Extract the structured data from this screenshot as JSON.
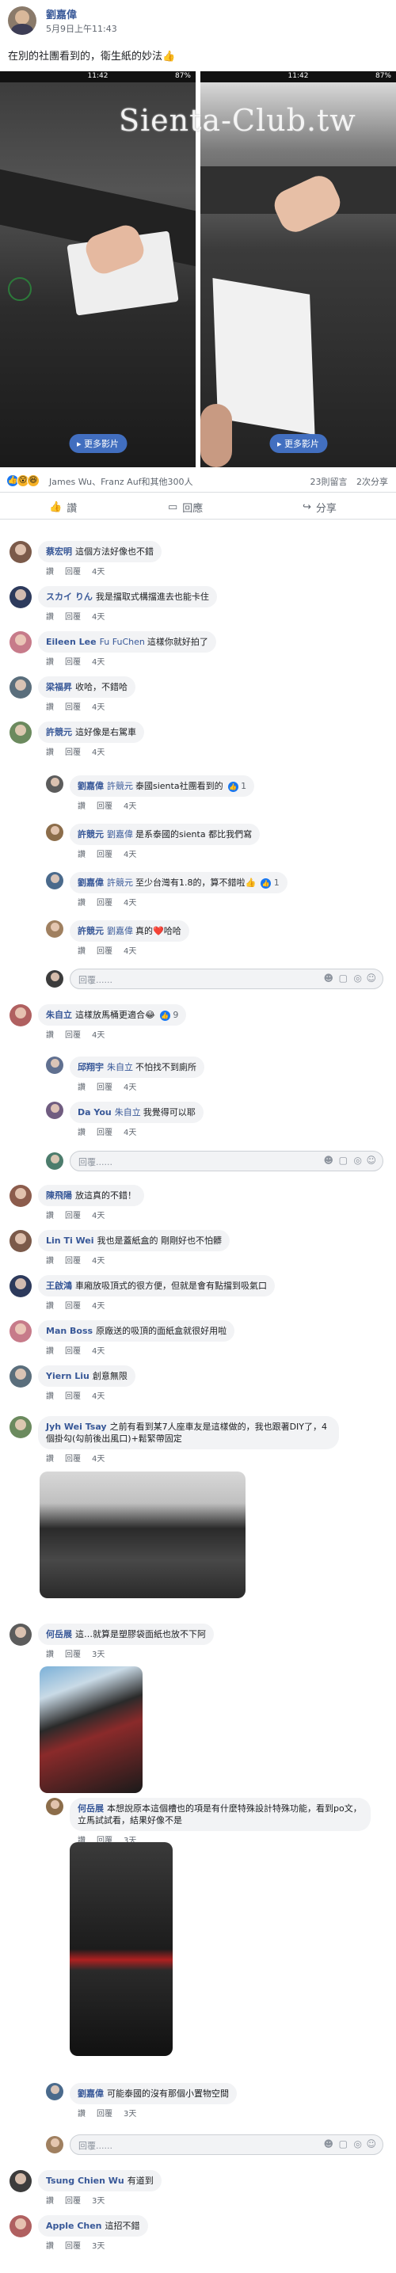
{
  "post": {
    "author": "劉嘉偉",
    "time": "5月9日上午11:43",
    "text": "在別的社團看到的，衛生紙的妙法👍",
    "watermark": "Sienta-Club.tw"
  },
  "photos": [
    {
      "status_time": "11:42",
      "battery": "87%",
      "button": "更多影片"
    },
    {
      "status_time": "11:42",
      "battery": "87%",
      "button": "更多影片"
    }
  ],
  "reactions": {
    "summary": "James Wu、Franz Auf和其他300人",
    "comments_count": "23則留言",
    "shares_count": "2次分享"
  },
  "actions": {
    "like": "讚",
    "comment": "回應",
    "share": "分享"
  },
  "labels": {
    "reply": "回覆",
    "like": "讚",
    "input_placeholder": "回覆......"
  },
  "comments": [
    {
      "name": "蔡宏明",
      "text": "這個方法好像也不錯",
      "time": "4天"
    },
    {
      "name": "スカイ りん",
      "text": "我是擋取式構擋進去也能卡住",
      "time": "4天"
    },
    {
      "name": "Eileen Lee",
      "tag": "Fu FuChen",
      "text": "這樣你就好拍了",
      "time": "4天"
    },
    {
      "name": "梁福昇",
      "text": "收哈，不錯哈",
      "time": "4天"
    },
    {
      "name": "許競元",
      "text": "這好像是右駕車",
      "time": "4天",
      "replies": [
        {
          "name": "劉嘉偉",
          "tag": "許競元",
          "text": "泰國sienta社團看到的",
          "time": "4天",
          "likes": "1"
        },
        {
          "name": "許競元",
          "tag": "劉嘉偉",
          "text": "是系泰國的sienta 都比我們寫",
          "time": "4天"
        },
        {
          "name": "劉嘉偉",
          "tag": "許競元",
          "text": "至少台灣有1.8的，算不錯啦👍",
          "time": "4天",
          "likes": "1"
        },
        {
          "name": "許競元",
          "tag": "劉嘉偉",
          "text": "真的❤️哈哈",
          "time": "4天"
        }
      ]
    },
    {
      "name": "朱自立",
      "text": "這樣放馬桶更適合😂",
      "time": "4天",
      "likes": "9",
      "replies": [
        {
          "name": "邱翔宇",
          "tag": "朱自立",
          "text": "不怕找不到廁所",
          "time": "4天"
        },
        {
          "name": "Da You",
          "tag": "朱自立",
          "text": "我覺得可以耶",
          "time": "4天"
        }
      ]
    },
    {
      "name": "陳飛陽",
      "text": "放這真的不錯！",
      "time": "4天"
    },
    {
      "name": "Lin Ti Wei",
      "text": "我也是蓋紙盒的 剛剛好也不怕髒",
      "time": "4天"
    },
    {
      "name": "王啟鴻",
      "text": "車廂放吸頂式的很方便，但就是會有點擋到吸氣口",
      "time": "4天"
    },
    {
      "name": "Man Boss",
      "text": "原廠送的吸頂的面紙盒就很好用啦",
      "time": "4天"
    },
    {
      "name": "Yiern Liu",
      "text": "創意無限",
      "time": "4天"
    },
    {
      "name": "Jyh Wei Tsay",
      "text": "之前有看到某7人座車友是這樣做的，我也跟著DIY了，4個掛勾(勾前後出風口)+鬆緊帶固定",
      "time": "4天"
    },
    {
      "name": "何岳展",
      "text": "這…就算是塑膠袋面紙也放不下阿",
      "time": "3天",
      "replies": [
        {
          "name": "何岳展",
          "text": "本想說原本這個槽也的項是有什麼特殊設計特殊功能，看到po文，立馬試試看，結果好像不是",
          "time": "3天"
        },
        {
          "name": "劉嘉偉",
          "text": "可能泰國的沒有那個小置物空間",
          "time": "3天"
        }
      ]
    },
    {
      "name": "Tsung Chien Wu",
      "text": "有道到",
      "time": "3天"
    },
    {
      "name": "Apple Chen",
      "text": "這招不錯",
      "time": "3天"
    }
  ]
}
